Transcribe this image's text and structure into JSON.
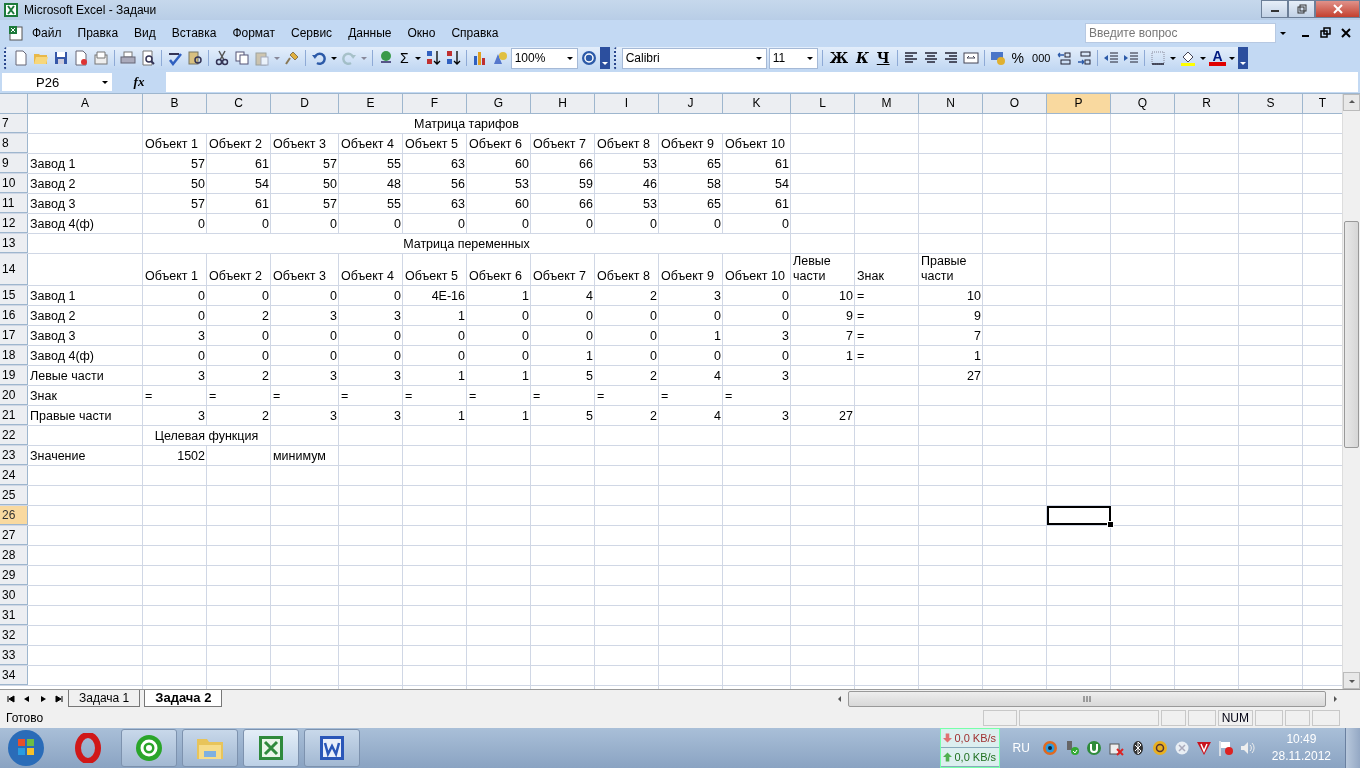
{
  "window": {
    "title": "Microsoft Excel - Задачи"
  },
  "menu": [
    "Файл",
    "Правка",
    "Вид",
    "Вставка",
    "Формат",
    "Сервис",
    "Данные",
    "Окно",
    "Справка"
  ],
  "help_box": {
    "placeholder": "Введите вопрос"
  },
  "standard_toolbar": {
    "sum": "Σ",
    "zoom": "100%"
  },
  "format_toolbar": {
    "font": "Calibri",
    "size": "11",
    "bold": "Ж",
    "italic": "К",
    "underline": "Ч",
    "percent": "%",
    "thousands": "000",
    "font_color": "A"
  },
  "formula_bar": {
    "name_box": "P26",
    "fx": "fx"
  },
  "sheet": {
    "columns": [
      {
        "label": "A",
        "selected": false
      },
      {
        "label": "B",
        "selected": false
      },
      {
        "label": "C",
        "selected": false
      },
      {
        "label": "D",
        "selected": false
      },
      {
        "label": "E",
        "selected": false
      },
      {
        "label": "F",
        "selected": false
      },
      {
        "label": "G",
        "selected": false
      },
      {
        "label": "H",
        "selected": false
      },
      {
        "label": "I",
        "selected": false
      },
      {
        "label": "J",
        "selected": false
      },
      {
        "label": "K",
        "selected": false
      },
      {
        "label": "L",
        "selected": false
      },
      {
        "label": "M",
        "selected": false
      },
      {
        "label": "N",
        "selected": false
      },
      {
        "label": "O",
        "selected": false
      },
      {
        "label": "P",
        "selected": true
      },
      {
        "label": "Q",
        "selected": false
      },
      {
        "label": "R",
        "selected": false
      },
      {
        "label": "S",
        "selected": false
      },
      {
        "label": "T",
        "selected": false
      }
    ],
    "rows": [
      {
        "label": "7",
        "selected": false,
        "cells": {
          "B": {
            "text": "Матрица тарифов",
            "kind": "title"
          }
        }
      },
      {
        "label": "8",
        "selected": false,
        "cells": {
          "B": {
            "text": "Объект 1",
            "kind": "text"
          },
          "C": {
            "text": "Объект 2",
            "kind": "text"
          },
          "D": {
            "text": "Объект 3",
            "kind": "text"
          },
          "E": {
            "text": "Объект 4",
            "kind": "text"
          },
          "F": {
            "text": "Объект 5",
            "kind": "text"
          },
          "G": {
            "text": "Объект 6",
            "kind": "text"
          },
          "H": {
            "text": "Объект 7",
            "kind": "text"
          },
          "I": {
            "text": "Объект 8",
            "kind": "text"
          },
          "J": {
            "text": "Объект 9",
            "kind": "text"
          },
          "K": {
            "text": "Объект 10",
            "kind": "text"
          }
        }
      },
      {
        "label": "9",
        "selected": false,
        "cells": {
          "A": {
            "text": "Завод 1",
            "kind": "text"
          },
          "B": {
            "text": "57",
            "kind": "num"
          },
          "C": {
            "text": "61",
            "kind": "num"
          },
          "D": {
            "text": "57",
            "kind": "num"
          },
          "E": {
            "text": "55",
            "kind": "num"
          },
          "F": {
            "text": "63",
            "kind": "num"
          },
          "G": {
            "text": "60",
            "kind": "num"
          },
          "H": {
            "text": "66",
            "kind": "num"
          },
          "I": {
            "text": "53",
            "kind": "num"
          },
          "J": {
            "text": "65",
            "kind": "num"
          },
          "K": {
            "text": "61",
            "kind": "num"
          }
        }
      },
      {
        "label": "10",
        "selected": false,
        "cells": {
          "A": {
            "text": "Завод 2",
            "kind": "text"
          },
          "B": {
            "text": "50",
            "kind": "num"
          },
          "C": {
            "text": "54",
            "kind": "num"
          },
          "D": {
            "text": "50",
            "kind": "num"
          },
          "E": {
            "text": "48",
            "kind": "num"
          },
          "F": {
            "text": "56",
            "kind": "num"
          },
          "G": {
            "text": "53",
            "kind": "num"
          },
          "H": {
            "text": "59",
            "kind": "num"
          },
          "I": {
            "text": "46",
            "kind": "num"
          },
          "J": {
            "text": "58",
            "kind": "num"
          },
          "K": {
            "text": "54",
            "kind": "num"
          }
        }
      },
      {
        "label": "11",
        "selected": false,
        "cells": {
          "A": {
            "text": "Завод 3",
            "kind": "text"
          },
          "B": {
            "text": "57",
            "kind": "num"
          },
          "C": {
            "text": "61",
            "kind": "num"
          },
          "D": {
            "text": "57",
            "kind": "num"
          },
          "E": {
            "text": "55",
            "kind": "num"
          },
          "F": {
            "text": "63",
            "kind": "num"
          },
          "G": {
            "text": "60",
            "kind": "num"
          },
          "H": {
            "text": "66",
            "kind": "num"
          },
          "I": {
            "text": "53",
            "kind": "num"
          },
          "J": {
            "text": "65",
            "kind": "num"
          },
          "K": {
            "text": "61",
            "kind": "num"
          }
        }
      },
      {
        "label": "12",
        "selected": false,
        "cells": {
          "A": {
            "text": "Завод 4(ф)",
            "kind": "text"
          },
          "B": {
            "text": "0",
            "kind": "num"
          },
          "C": {
            "text": "0",
            "kind": "num"
          },
          "D": {
            "text": "0",
            "kind": "num"
          },
          "E": {
            "text": "0",
            "kind": "num"
          },
          "F": {
            "text": "0",
            "kind": "num"
          },
          "G": {
            "text": "0",
            "kind": "num"
          },
          "H": {
            "text": "0",
            "kind": "num"
          },
          "I": {
            "text": "0",
            "kind": "num"
          },
          "J": {
            "text": "0",
            "kind": "num"
          },
          "K": {
            "text": "0",
            "kind": "num"
          }
        }
      },
      {
        "label": "13",
        "selected": false,
        "cells": {
          "B": {
            "text": "Матрица переменных",
            "kind": "title"
          }
        }
      },
      {
        "label": "14",
        "selected": false,
        "cells": {
          "B": {
            "text": "Объект 1",
            "kind": "text"
          },
          "C": {
            "text": "Объект 2",
            "kind": "text"
          },
          "D": {
            "text": "Объект 3",
            "kind": "text"
          },
          "E": {
            "text": "Объект 4",
            "kind": "text"
          },
          "F": {
            "text": "Объект 5",
            "kind": "text"
          },
          "G": {
            "text": "Объект 6",
            "kind": "text"
          },
          "H": {
            "text": "Объект 7",
            "kind": "text"
          },
          "I": {
            "text": "Объект 8",
            "kind": "text"
          },
          "J": {
            "text": "Объект 9",
            "kind": "text"
          },
          "K": {
            "text": "Объект 10",
            "kind": "text"
          },
          "L": {
            "text": "Левые части",
            "kind": "text"
          },
          "M": {
            "text": "Знак",
            "kind": "text"
          },
          "N": {
            "text": "Правые части",
            "kind": "text"
          }
        }
      },
      {
        "label": "15",
        "selected": false,
        "cells": {
          "A": {
            "text": "Завод 1",
            "kind": "text"
          },
          "B": {
            "text": "0",
            "kind": "num"
          },
          "C": {
            "text": "0",
            "kind": "num"
          },
          "D": {
            "text": "0",
            "kind": "num"
          },
          "E": {
            "text": "0",
            "kind": "num"
          },
          "F": {
            "text": "4E-16",
            "kind": "num"
          },
          "G": {
            "text": "1",
            "kind": "num"
          },
          "H": {
            "text": "4",
            "kind": "num"
          },
          "I": {
            "text": "2",
            "kind": "num"
          },
          "J": {
            "text": "3",
            "kind": "num"
          },
          "K": {
            "text": "0",
            "kind": "num"
          },
          "L": {
            "text": "10",
            "kind": "num"
          },
          "M": {
            "text": "=",
            "kind": "text"
          },
          "N": {
            "text": "10",
            "kind": "num"
          }
        }
      },
      {
        "label": "16",
        "selected": false,
        "cells": {
          "A": {
            "text": "Завод 2",
            "kind": "text"
          },
          "B": {
            "text": "0",
            "kind": "num"
          },
          "C": {
            "text": "2",
            "kind": "num"
          },
          "D": {
            "text": "3",
            "kind": "num"
          },
          "E": {
            "text": "3",
            "kind": "num"
          },
          "F": {
            "text": "1",
            "kind": "num"
          },
          "G": {
            "text": "0",
            "kind": "num"
          },
          "H": {
            "text": "0",
            "kind": "num"
          },
          "I": {
            "text": "0",
            "kind": "num"
          },
          "J": {
            "text": "0",
            "kind": "num"
          },
          "K": {
            "text": "0",
            "kind": "num"
          },
          "L": {
            "text": "9",
            "kind": "num"
          },
          "M": {
            "text": "=",
            "kind": "text"
          },
          "N": {
            "text": "9",
            "kind": "num"
          }
        }
      },
      {
        "label": "17",
        "selected": false,
        "cells": {
          "A": {
            "text": "Завод 3",
            "kind": "text"
          },
          "B": {
            "text": "3",
            "kind": "num"
          },
          "C": {
            "text": "0",
            "kind": "num"
          },
          "D": {
            "text": "0",
            "kind": "num"
          },
          "E": {
            "text": "0",
            "kind": "num"
          },
          "F": {
            "text": "0",
            "kind": "num"
          },
          "G": {
            "text": "0",
            "kind": "num"
          },
          "H": {
            "text": "0",
            "kind": "num"
          },
          "I": {
            "text": "0",
            "kind": "num"
          },
          "J": {
            "text": "1",
            "kind": "num"
          },
          "K": {
            "text": "3",
            "kind": "num"
          },
          "L": {
            "text": "7",
            "kind": "num"
          },
          "M": {
            "text": "=",
            "kind": "text"
          },
          "N": {
            "text": "7",
            "kind": "num"
          }
        }
      },
      {
        "label": "18",
        "selected": false,
        "cells": {
          "A": {
            "text": "Завод 4(ф)",
            "kind": "text"
          },
          "B": {
            "text": "0",
            "kind": "num"
          },
          "C": {
            "text": "0",
            "kind": "num"
          },
          "D": {
            "text": "0",
            "kind": "num"
          },
          "E": {
            "text": "0",
            "kind": "num"
          },
          "F": {
            "text": "0",
            "kind": "num"
          },
          "G": {
            "text": "0",
            "kind": "num"
          },
          "H": {
            "text": "1",
            "kind": "num"
          },
          "I": {
            "text": "0",
            "kind": "num"
          },
          "J": {
            "text": "0",
            "kind": "num"
          },
          "K": {
            "text": "0",
            "kind": "num"
          },
          "L": {
            "text": "1",
            "kind": "num"
          },
          "M": {
            "text": "=",
            "kind": "text"
          },
          "N": {
            "text": "1",
            "kind": "num"
          }
        }
      },
      {
        "label": "19",
        "selected": false,
        "cells": {
          "A": {
            "text": "Левые части",
            "kind": "text"
          },
          "B": {
            "text": "3",
            "kind": "num"
          },
          "C": {
            "text": "2",
            "kind": "num"
          },
          "D": {
            "text": "3",
            "kind": "num"
          },
          "E": {
            "text": "3",
            "kind": "num"
          },
          "F": {
            "text": "1",
            "kind": "num"
          },
          "G": {
            "text": "1",
            "kind": "num"
          },
          "H": {
            "text": "5",
            "kind": "num"
          },
          "I": {
            "text": "2",
            "kind": "num"
          },
          "J": {
            "text": "4",
            "kind": "num"
          },
          "K": {
            "text": "3",
            "kind": "num"
          },
          "N": {
            "text": "27",
            "kind": "num"
          }
        }
      },
      {
        "label": "20",
        "selected": false,
        "cells": {
          "A": {
            "text": "Знак",
            "kind": "text"
          },
          "B": {
            "text": "=",
            "kind": "text"
          },
          "C": {
            "text": "=",
            "kind": "text"
          },
          "D": {
            "text": "=",
            "kind": "text"
          },
          "E": {
            "text": "=",
            "kind": "text"
          },
          "F": {
            "text": "=",
            "kind": "text"
          },
          "G": {
            "text": "=",
            "kind": "text"
          },
          "H": {
            "text": "=",
            "kind": "text"
          },
          "I": {
            "text": "=",
            "kind": "text"
          },
          "J": {
            "text": "=",
            "kind": "text"
          },
          "K": {
            "text": "=",
            "kind": "text"
          }
        }
      },
      {
        "label": "21",
        "selected": false,
        "cells": {
          "A": {
            "text": "Правые части",
            "kind": "text"
          },
          "B": {
            "text": "3",
            "kind": "num"
          },
          "C": {
            "text": "2",
            "kind": "num"
          },
          "D": {
            "text": "3",
            "kind": "num"
          },
          "E": {
            "text": "3",
            "kind": "num"
          },
          "F": {
            "text": "1",
            "kind": "num"
          },
          "G": {
            "text": "1",
            "kind": "num"
          },
          "H": {
            "text": "5",
            "kind": "num"
          },
          "I": {
            "text": "2",
            "kind": "num"
          },
          "J": {
            "text": "4",
            "kind": "num"
          },
          "K": {
            "text": "3",
            "kind": "num"
          },
          "L": {
            "text": "27",
            "kind": "num"
          }
        }
      },
      {
        "label": "22",
        "selected": false,
        "cells": {
          "B": {
            "text": "Целевая функция",
            "kind": "caption"
          }
        }
      },
      {
        "label": "23",
        "selected": false,
        "cells": {
          "A": {
            "text": "Значение",
            "kind": "text"
          },
          "B": {
            "text": "1502",
            "kind": "num"
          },
          "D": {
            "text": "минимум",
            "kind": "text"
          }
        }
      },
      {
        "label": "24",
        "selected": false
      },
      {
        "label": "25",
        "selected": false
      },
      {
        "label": "26",
        "selected": true
      },
      {
        "label": "27",
        "selected": false
      },
      {
        "label": "28",
        "selected": false
      },
      {
        "label": "29",
        "selected": false
      },
      {
        "label": "30",
        "selected": false
      },
      {
        "label": "31",
        "selected": false
      },
      {
        "label": "32",
        "selected": false
      },
      {
        "label": "33",
        "selected": false
      },
      {
        "label": "34",
        "selected": false
      }
    ]
  },
  "sheet_tabs": [
    {
      "label": "Задача 1",
      "selected": false
    },
    {
      "label": "Задача 2",
      "selected": true
    }
  ],
  "status_bar": {
    "text": "Готово",
    "num": "NUM"
  },
  "taskbar": {
    "net_down": "0,0 KB/s",
    "net_up": "0,0 KB/s",
    "language": "RU",
    "time": "10:49",
    "date": "28.11.2012"
  }
}
